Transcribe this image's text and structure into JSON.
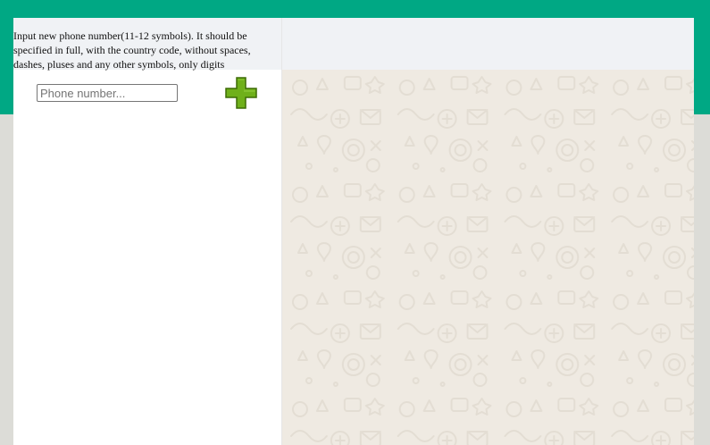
{
  "instructions": {
    "line1": "Input new phone number(11-12 symbols). It should be",
    "line2": "specified in full, with the country code, without spaces,",
    "line3": "dashes, pluses and any other symbols, only digits"
  },
  "phone_field": {
    "value": "",
    "placeholder": "Phone number..."
  },
  "add_button": {
    "icon": "plus-icon",
    "color": "#5a9a0c"
  },
  "colors": {
    "brand": "#00a884",
    "chat_background": "#efeae2",
    "header_background": "#f0f2f5"
  }
}
